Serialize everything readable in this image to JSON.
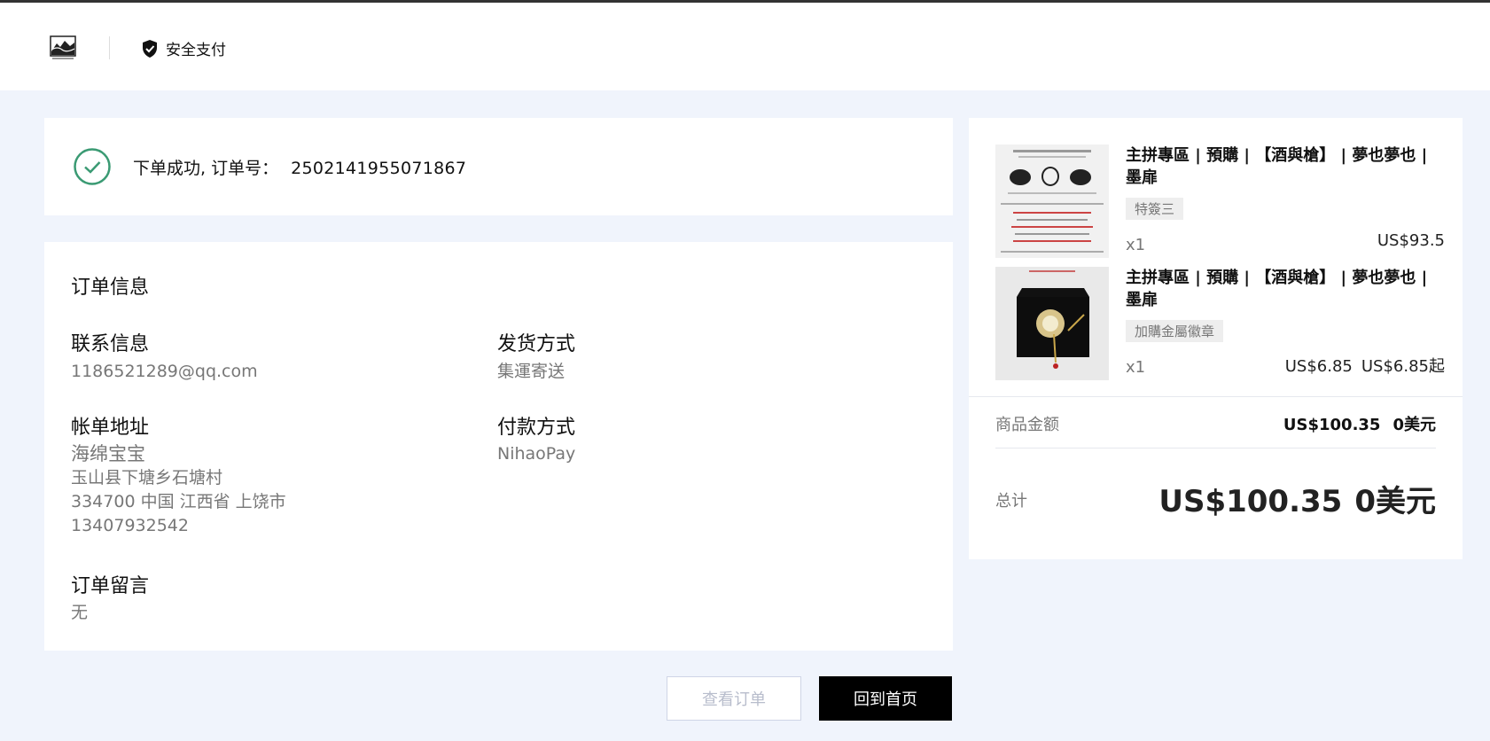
{
  "header": {
    "logo_icon": "mountain-logo-icon",
    "secure_label": "安全支付",
    "secure_icon": "shield-check-icon"
  },
  "success": {
    "icon": "check-circle-icon",
    "label": "下单成功, 订单号：",
    "order_number": "2502141955071867"
  },
  "order_info": {
    "title": "订单信息",
    "contact": {
      "heading": "联系信息",
      "value": "1186521289@qq.com"
    },
    "shipping": {
      "heading": "发货方式",
      "value": "集運寄送"
    },
    "billing": {
      "heading": "帐单地址",
      "name": "海绵宝宝",
      "line1": "玉山县下塘乡石塘村",
      "line2": "334700 中国 江西省 上饶市",
      "phone": "13407932542"
    },
    "payment": {
      "heading": "付款方式",
      "value": "NihaoPay"
    },
    "note": {
      "heading": "订单留言",
      "value": "无"
    }
  },
  "buttons": {
    "view_orders": "查看订单",
    "back_home": "回到首页"
  },
  "summary": {
    "products": [
      {
        "title": "主拼專區 | 預購 | 【酒與槍】 | 夢也夢也 | 墨扉",
        "variant": "特簽三",
        "qty": "x1",
        "price": "US$93.5",
        "price_extra": ""
      },
      {
        "title": "主拼專區 | 預購 | 【酒與槍】 | 夢也夢也 | 墨扉",
        "variant": "加購金屬徽章",
        "qty": "x1",
        "price": "US$6.85",
        "price_extra": "US$6.85起"
      }
    ],
    "subtotal_label": "商品金额",
    "subtotal_value": "US$100.35",
    "subtotal_alt": "0美元",
    "total_label": "总计",
    "total_value": "US$100.35",
    "total_alt": "0美元"
  }
}
